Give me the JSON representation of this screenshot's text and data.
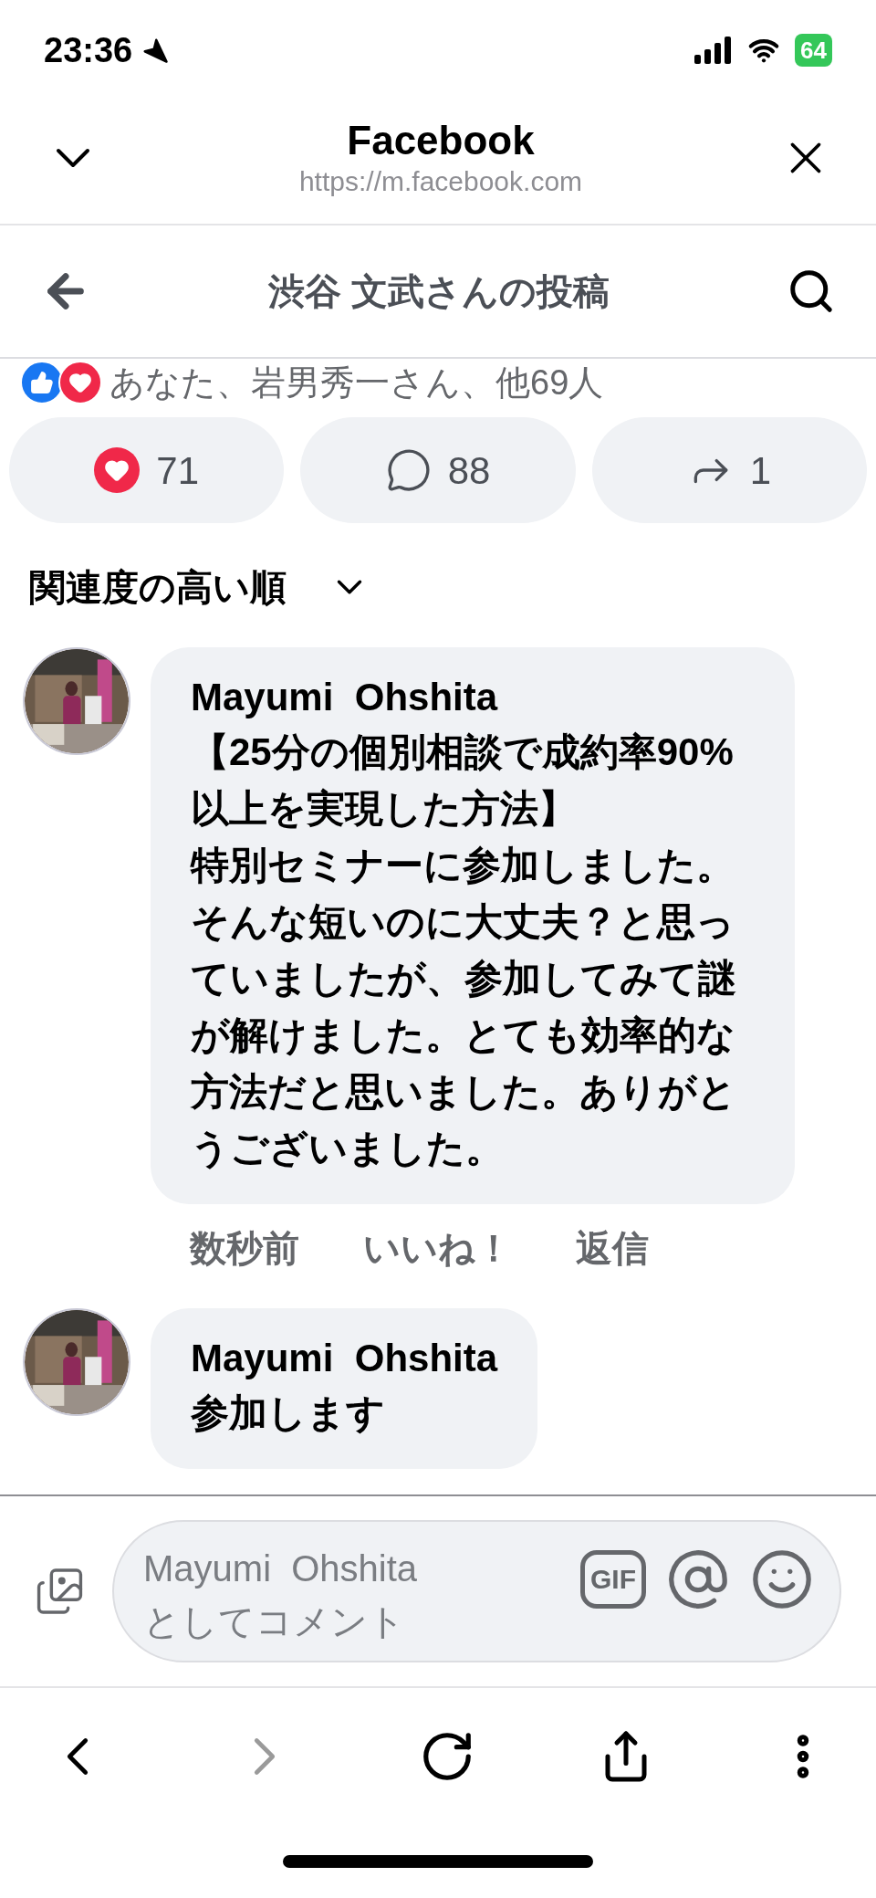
{
  "status_bar": {
    "time": "23:36",
    "battery": "64"
  },
  "browser_header": {
    "title": "Facebook",
    "url": "https://m.facebook.com"
  },
  "page_header": {
    "title": "渋谷 文武さんの投稿"
  },
  "reactions": {
    "summary": "あなた、岩男秀一さん、他69人"
  },
  "actions": [
    {
      "kind": "love",
      "count": "71"
    },
    {
      "kind": "comment",
      "count": "88"
    },
    {
      "kind": "share",
      "count": "1"
    }
  ],
  "sort": {
    "label": "関連度の高い順"
  },
  "comments": [
    {
      "author": "Mayumi  Ohshita",
      "text": [
        "【25分の個別相談で成約率90%以上を実現した方法】",
        "特別セミナーに参加しました。そんな短いのに大丈夫？と思っていましたが、参加してみて謎が解けました。とても効率的な方法だと思いました。ありがとうございました。"
      ],
      "meta": [
        "数秒前",
        "いいね！",
        "返信"
      ]
    },
    {
      "author": "Mayumi  Ohshita",
      "text": [
        "参加します"
      ]
    }
  ],
  "composer": {
    "placeholder": "Mayumi  Ohshita\nとしてコメント",
    "gif_label": "GIF"
  }
}
